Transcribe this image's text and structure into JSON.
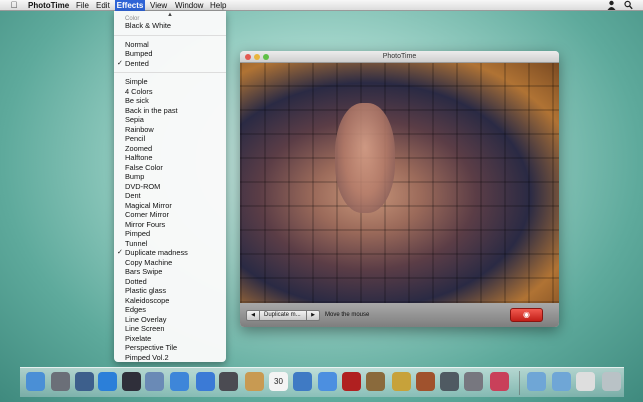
{
  "menubar": {
    "apple_icon": "apple-icon",
    "app_name": "PhotoTime",
    "menus": [
      "File",
      "Edit",
      "Effects",
      "View",
      "Window",
      "Help"
    ],
    "active_menu": "Effects"
  },
  "effects_menu": {
    "cut_off_top": "Color",
    "groups": [
      [
        {
          "label": "Black & White",
          "checked": false
        }
      ],
      [
        {
          "label": "Normal",
          "checked": false
        },
        {
          "label": "Bumped",
          "checked": false
        },
        {
          "label": "Dented",
          "checked": true
        }
      ],
      [
        {
          "label": "Simple",
          "checked": false
        },
        {
          "label": "4 Colors",
          "checked": false
        },
        {
          "label": "Be sick",
          "checked": false
        },
        {
          "label": "Back in the past",
          "checked": false
        },
        {
          "label": "Sepia",
          "checked": false
        },
        {
          "label": "Rainbow",
          "checked": false
        },
        {
          "label": "Pencil",
          "checked": false
        },
        {
          "label": "Zoomed",
          "checked": false
        },
        {
          "label": "Halftone",
          "checked": false
        },
        {
          "label": "False Color",
          "checked": false
        },
        {
          "label": "Bump",
          "checked": false
        },
        {
          "label": "DVD-ROM",
          "checked": false
        },
        {
          "label": "Dent",
          "checked": false
        },
        {
          "label": "Magical Mirror",
          "checked": false
        },
        {
          "label": "Corner Mirror",
          "checked": false
        },
        {
          "label": "Mirror Fours",
          "checked": false
        },
        {
          "label": "Pimped",
          "checked": false
        },
        {
          "label": "Tunnel",
          "checked": false
        },
        {
          "label": "Duplicate madness",
          "checked": true
        },
        {
          "label": "Copy Machine",
          "checked": false
        },
        {
          "label": "Bars Swipe",
          "checked": false
        },
        {
          "label": "Dotted",
          "checked": false
        },
        {
          "label": "Plastic glass",
          "checked": false
        },
        {
          "label": "Kaleidoscope",
          "checked": false
        },
        {
          "label": "Edges",
          "checked": false
        },
        {
          "label": "Line Overlay",
          "checked": false
        },
        {
          "label": "Line Screen",
          "checked": false
        },
        {
          "label": "Pixelate",
          "checked": false
        },
        {
          "label": "Perspective Tile",
          "checked": false
        },
        {
          "label": "Pimped Vol.2",
          "checked": false
        }
      ]
    ]
  },
  "window": {
    "title": "PhotoTime",
    "effect_selector": "Duplicate m...",
    "hint": "Move the mouse"
  },
  "dock": {
    "icons": [
      "finder-icon",
      "launchpad-icon",
      "mission-control-icon",
      "app-store-icon",
      "dashboard-icon",
      "preview-icon",
      "safari-icon",
      "facetime-icon",
      "photo-booth-icon",
      "address-book-icon",
      "calendar-icon",
      "iphoto-icon",
      "itunes-icon",
      "photo-time-icon",
      "image-capture-icon",
      "star-icon",
      "garageband-icon",
      "time-machine-icon",
      "system-preferences-icon",
      "color-icon",
      "applications-folder-icon",
      "documents-folder-icon",
      "downloads-icon",
      "trash-icon"
    ],
    "calendar_day": "30"
  },
  "colors": {
    "menu_highlight": "#2f64d6",
    "camera_button": "#d9332b",
    "desktop": "#5eaa9c"
  }
}
